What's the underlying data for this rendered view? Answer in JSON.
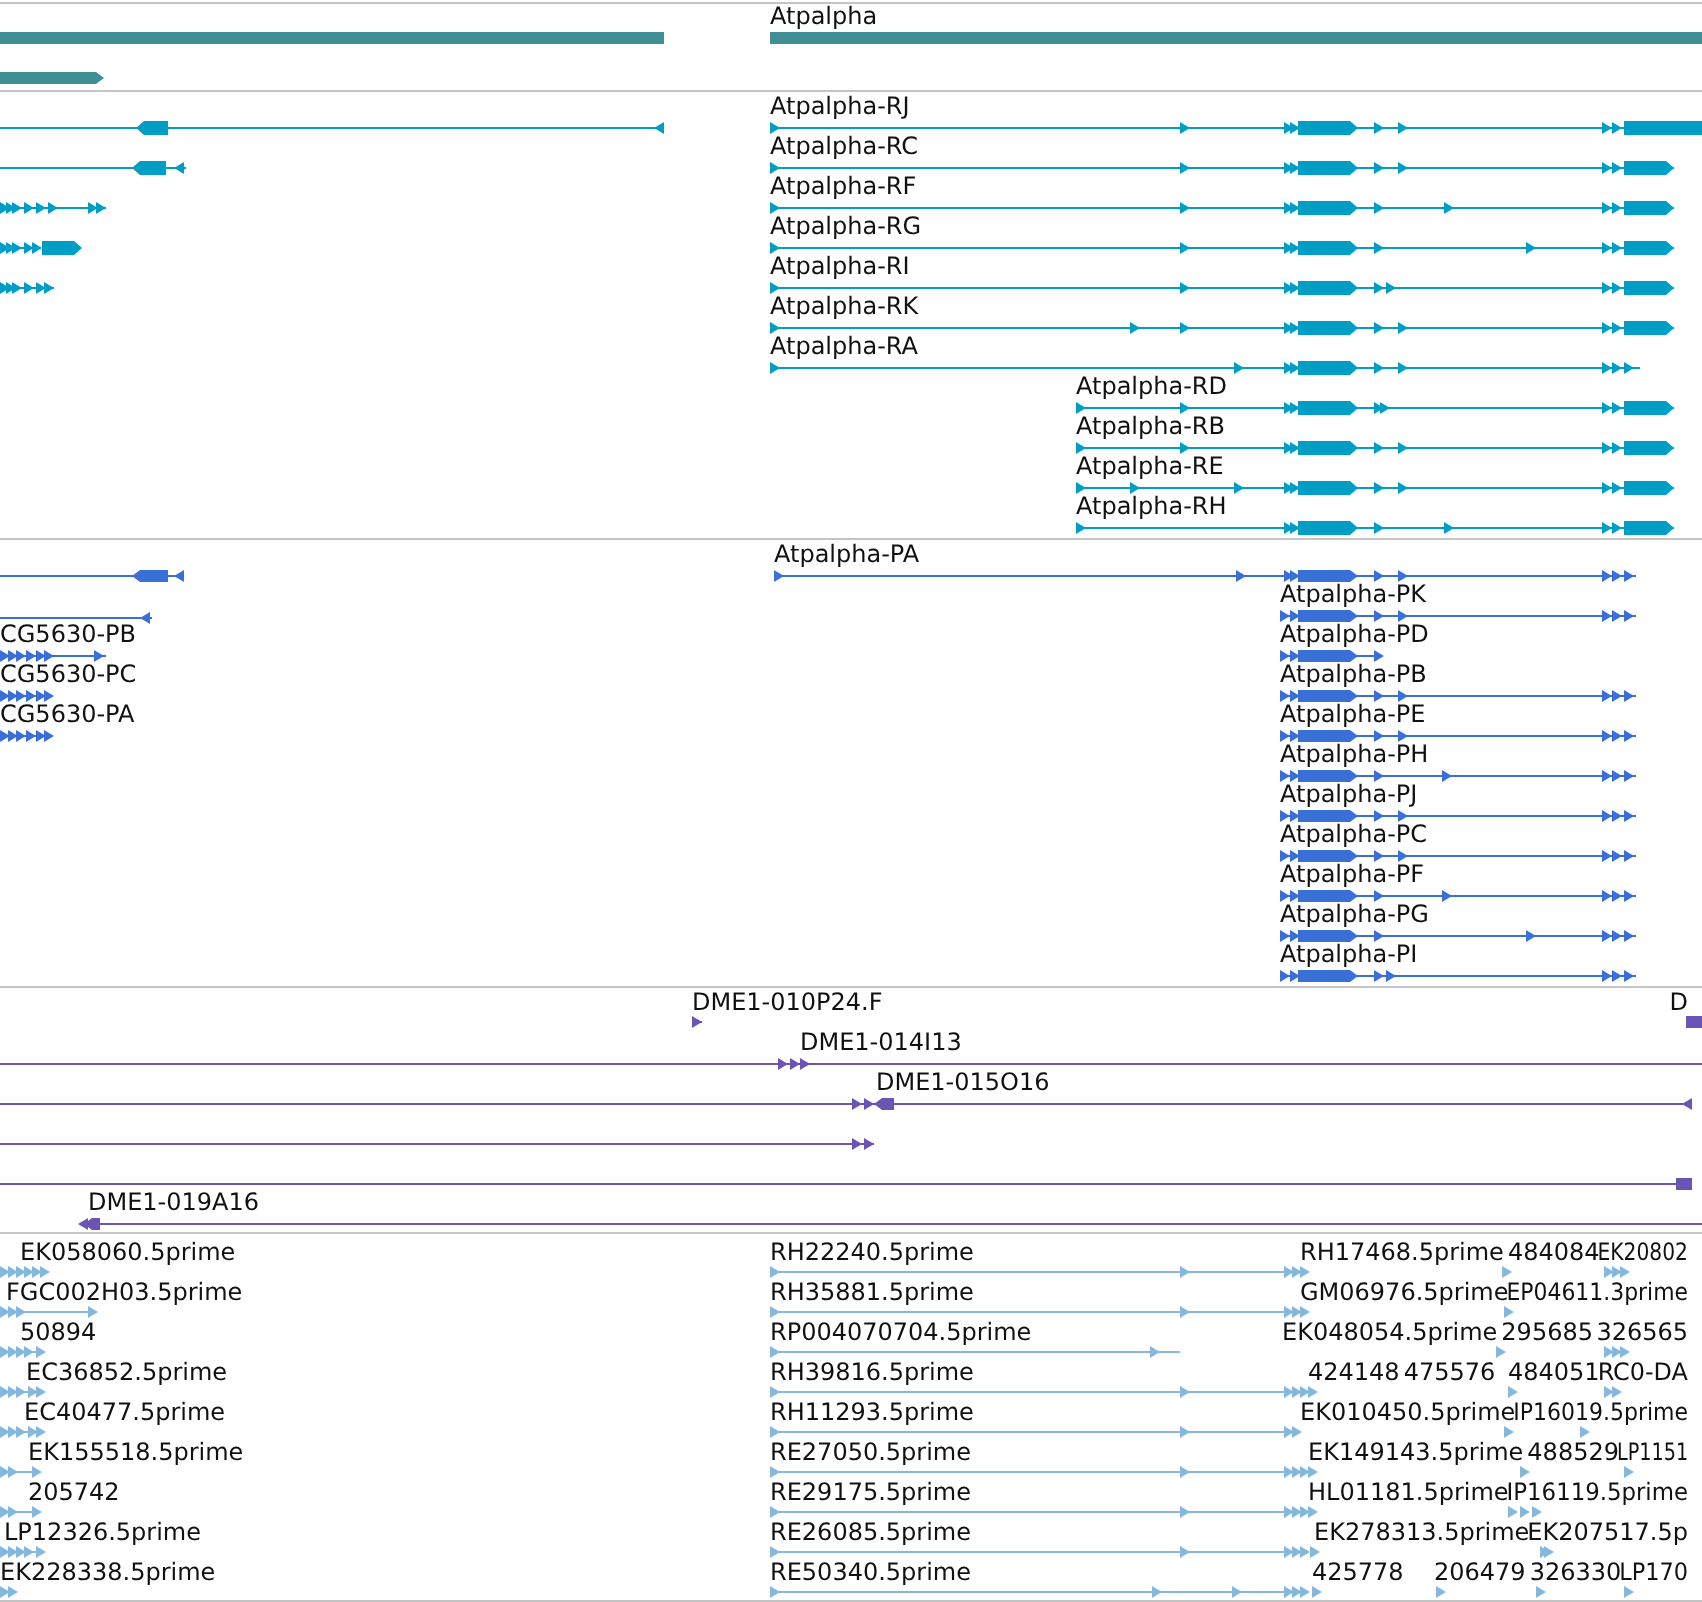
{
  "tracks": [
    {
      "kind": "gene",
      "features": [
        {
          "label": "Atpalpha"
        }
      ]
    },
    {
      "kind": "transcript",
      "features": [
        {
          "label": "Atpalpha-RJ"
        },
        {
          "label": "Atpalpha-RC"
        },
        {
          "label": "Atpalpha-RF"
        },
        {
          "label": "Atpalpha-RG"
        },
        {
          "label": "Atpalpha-RI"
        },
        {
          "label": "Atpalpha-RK"
        },
        {
          "label": "Atpalpha-RA"
        },
        {
          "label": "Atpalpha-RD"
        },
        {
          "label": "Atpalpha-RB"
        },
        {
          "label": "Atpalpha-RE"
        },
        {
          "label": "Atpalpha-RH"
        }
      ]
    },
    {
      "kind": "protein",
      "features": [
        {
          "label": "CG5630-PB"
        },
        {
          "label": "CG5630-PC"
        },
        {
          "label": "CG5630-PA"
        },
        {
          "label": "Atpalpha-PA"
        },
        {
          "label": "Atpalpha-PK"
        },
        {
          "label": "Atpalpha-PD"
        },
        {
          "label": "Atpalpha-PB"
        },
        {
          "label": "Atpalpha-PE"
        },
        {
          "label": "Atpalpha-PH"
        },
        {
          "label": "Atpalpha-PJ"
        },
        {
          "label": "Atpalpha-PC"
        },
        {
          "label": "Atpalpha-PF"
        },
        {
          "label": "Atpalpha-PG"
        },
        {
          "label": "Atpalpha-PI"
        }
      ]
    },
    {
      "kind": "clone",
      "features": [
        {
          "label": "DME1-010P24.F"
        },
        {
          "label": "D"
        },
        {
          "label": "DME1-014I13"
        },
        {
          "label": "DME1-015O16"
        },
        {
          "label": "DME1-019A16"
        }
      ]
    },
    {
      "kind": "est",
      "features": [
        {
          "label": "EK058060.5prime"
        },
        {
          "label": "RH22240.5prime"
        },
        {
          "label": "RH17468.5prime"
        },
        {
          "label": "484084"
        },
        {
          "label": "EK20802"
        },
        {
          "label": "FGC002H03.5prime"
        },
        {
          "label": "RH35881.5prime"
        },
        {
          "label": "GM06976.5prime"
        },
        {
          "label": "EP04611.3prime"
        },
        {
          "label": "50894"
        },
        {
          "label": "RP004070704.5prime"
        },
        {
          "label": "EK048054.5prime"
        },
        {
          "label": "295685"
        },
        {
          "label": "326565"
        },
        {
          "label": "EC36852.5prime"
        },
        {
          "label": "RH39816.5prime"
        },
        {
          "label": "424148"
        },
        {
          "label": "475576"
        },
        {
          "label": "484051"
        },
        {
          "label": "RC0-DA"
        },
        {
          "label": "EC40477.5prime"
        },
        {
          "label": "RH11293.5prime"
        },
        {
          "label": "EK010450.5prime"
        },
        {
          "label": "IP16019.5prime"
        },
        {
          "label": "EK155518.5prime"
        },
        {
          "label": "RE27050.5prime"
        },
        {
          "label": "EK149143.5prime"
        },
        {
          "label": "488529"
        },
        {
          "label": "LP1151"
        },
        {
          "label": "205742"
        },
        {
          "label": "RE29175.5prime"
        },
        {
          "label": "HL01181.5prime"
        },
        {
          "label": "IP16119.5prime"
        },
        {
          "label": "LP12326.5prime"
        },
        {
          "label": "RE26085.5prime"
        },
        {
          "label": "EK278313.5prime"
        },
        {
          "label": "EK207517.5p"
        },
        {
          "label": "EK228338.5prime"
        },
        {
          "label": "RE50340.5prime"
        },
        {
          "label": "425778"
        },
        {
          "label": "206479"
        },
        {
          "label": "326330"
        },
        {
          "label": "LP170"
        }
      ]
    }
  ]
}
